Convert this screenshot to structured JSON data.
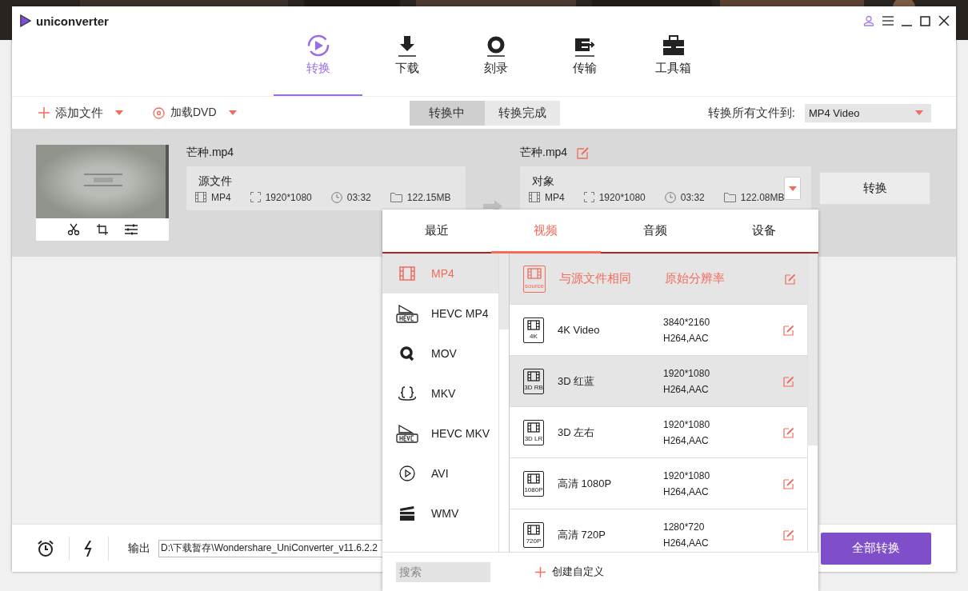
{
  "app": {
    "name": "uniconverter"
  },
  "nav_tabs": [
    {
      "label": "转换",
      "kind": "convert",
      "selected": true
    },
    {
      "label": "下载",
      "kind": "download",
      "selected": false
    },
    {
      "label": "刻录",
      "kind": "burn",
      "selected": false
    },
    {
      "label": "传输",
      "kind": "transfer",
      "selected": false
    },
    {
      "label": "工具箱",
      "kind": "toolbox",
      "selected": false
    }
  ],
  "toolbar": {
    "add_file": "添加文件",
    "load_dvd": "加载DVD",
    "status_tabs": [
      {
        "label": "转换中",
        "selected": true
      },
      {
        "label": "转换完成",
        "selected": false
      }
    ],
    "convert_all_label": "转换所有文件到:",
    "convert_all_value": "MP4 Video"
  },
  "file": {
    "source_name": "芒种.mp4",
    "source": {
      "title": "源文件",
      "format": "MP4",
      "resolution": "1920*1080",
      "duration": "03:32",
      "size": "122.15MB"
    },
    "target_name": "芒种.mp4",
    "target": {
      "title": "对象",
      "format": "MP4",
      "resolution": "1920*1080",
      "duration": "03:32",
      "size": "122.08MB"
    },
    "convert_button": "转换"
  },
  "bottom": {
    "output_label": "输出",
    "output_path": "D:\\下载暂存\\Wondershare_UniConverter_v11.6.2.2",
    "convert_all_button": "全部转换"
  },
  "format_popup": {
    "tabs": [
      {
        "label": "最近",
        "selected": false
      },
      {
        "label": "视频",
        "selected": true
      },
      {
        "label": "音频",
        "selected": false
      },
      {
        "label": "设备",
        "selected": false
      }
    ],
    "formats": [
      {
        "label": "MP4",
        "kind": "film",
        "selected": true
      },
      {
        "label": "HEVC MP4",
        "kind": "hevc",
        "selected": false
      },
      {
        "label": "MOV",
        "kind": "quicktime",
        "selected": false
      },
      {
        "label": "MKV",
        "kind": "braces",
        "selected": false
      },
      {
        "label": "HEVC MKV",
        "kind": "hevc",
        "selected": false
      },
      {
        "label": "AVI",
        "kind": "play",
        "selected": false
      },
      {
        "label": "WMV",
        "kind": "clapper",
        "selected": false
      }
    ],
    "presets": [
      {
        "kind": "source",
        "badge": "source",
        "name": "与源文件相同",
        "resolution": "原始分辨率",
        "selected": true,
        "hovered": false
      },
      {
        "kind": "file",
        "badge": "4K",
        "name": "4K Video",
        "resolution": "3840*2160",
        "codec": "H264,AAC",
        "selected": false,
        "hovered": false
      },
      {
        "kind": "file",
        "badge": "3D RB",
        "name": "3D 红蓝",
        "resolution": "1920*1080",
        "codec": "H264,AAC",
        "selected": false,
        "hovered": true
      },
      {
        "kind": "file",
        "badge": "3D LR",
        "name": "3D 左右",
        "resolution": "1920*1080",
        "codec": "H264,AAC",
        "selected": false,
        "hovered": false
      },
      {
        "kind": "file",
        "badge": "1080P",
        "name": "高清 1080P",
        "resolution": "1920*1080",
        "codec": "H264,AAC",
        "selected": false,
        "hovered": false
      },
      {
        "kind": "file",
        "badge": "720P",
        "name": "高清 720P",
        "resolution": "1280*720",
        "codec": "H264,AAC",
        "selected": false,
        "hovered": false
      }
    ],
    "search_placeholder": "搜索",
    "create_custom": "创建自定义"
  }
}
